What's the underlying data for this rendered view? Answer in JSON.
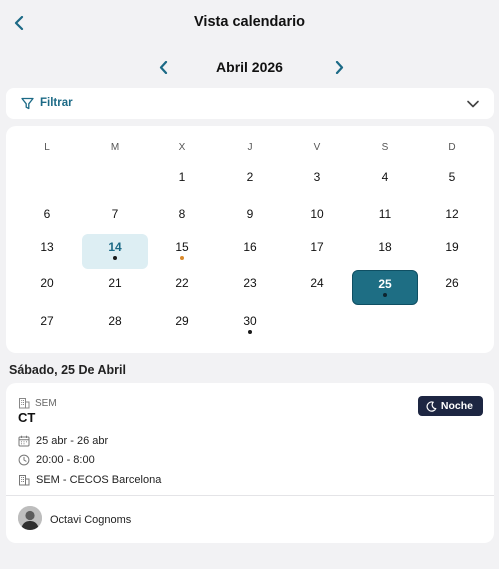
{
  "header": {
    "title": "Vista calendario"
  },
  "month_nav": {
    "label": "Abril 2026"
  },
  "filter": {
    "label": "Filtrar"
  },
  "calendar": {
    "weekdays": [
      "L",
      "M",
      "X",
      "J",
      "V",
      "S",
      "D"
    ],
    "weeks": [
      [
        null,
        null,
        1,
        2,
        3,
        4,
        5
      ],
      [
        6,
        7,
        8,
        9,
        10,
        11,
        12
      ],
      [
        13,
        14,
        15,
        16,
        17,
        18,
        19
      ],
      [
        20,
        21,
        22,
        23,
        24,
        25,
        26
      ],
      [
        27,
        28,
        29,
        30,
        null,
        null,
        null
      ]
    ],
    "today": 14,
    "selected": 25,
    "events": [
      {
        "day": 14,
        "dot_color": "#1a1a1a"
      },
      {
        "day": 15,
        "dot_color": "#d9892b"
      },
      {
        "day": 25,
        "dot_color": "#0d2530"
      },
      {
        "day": 30,
        "dot_color": "#1a1a1a"
      }
    ],
    "accent_color": "#1e6e84",
    "today_color": "#ddeef3"
  },
  "selected_date_heading": "Sábado, 25 De Abril",
  "event": {
    "type": "SEM",
    "code": "CT",
    "badge": "Noche",
    "date_range": "25 abr - 26 abr",
    "time_range": "20:00 - 8:00",
    "location": "SEM - CECOS Barcelona",
    "person": "Octavi Cognoms"
  }
}
